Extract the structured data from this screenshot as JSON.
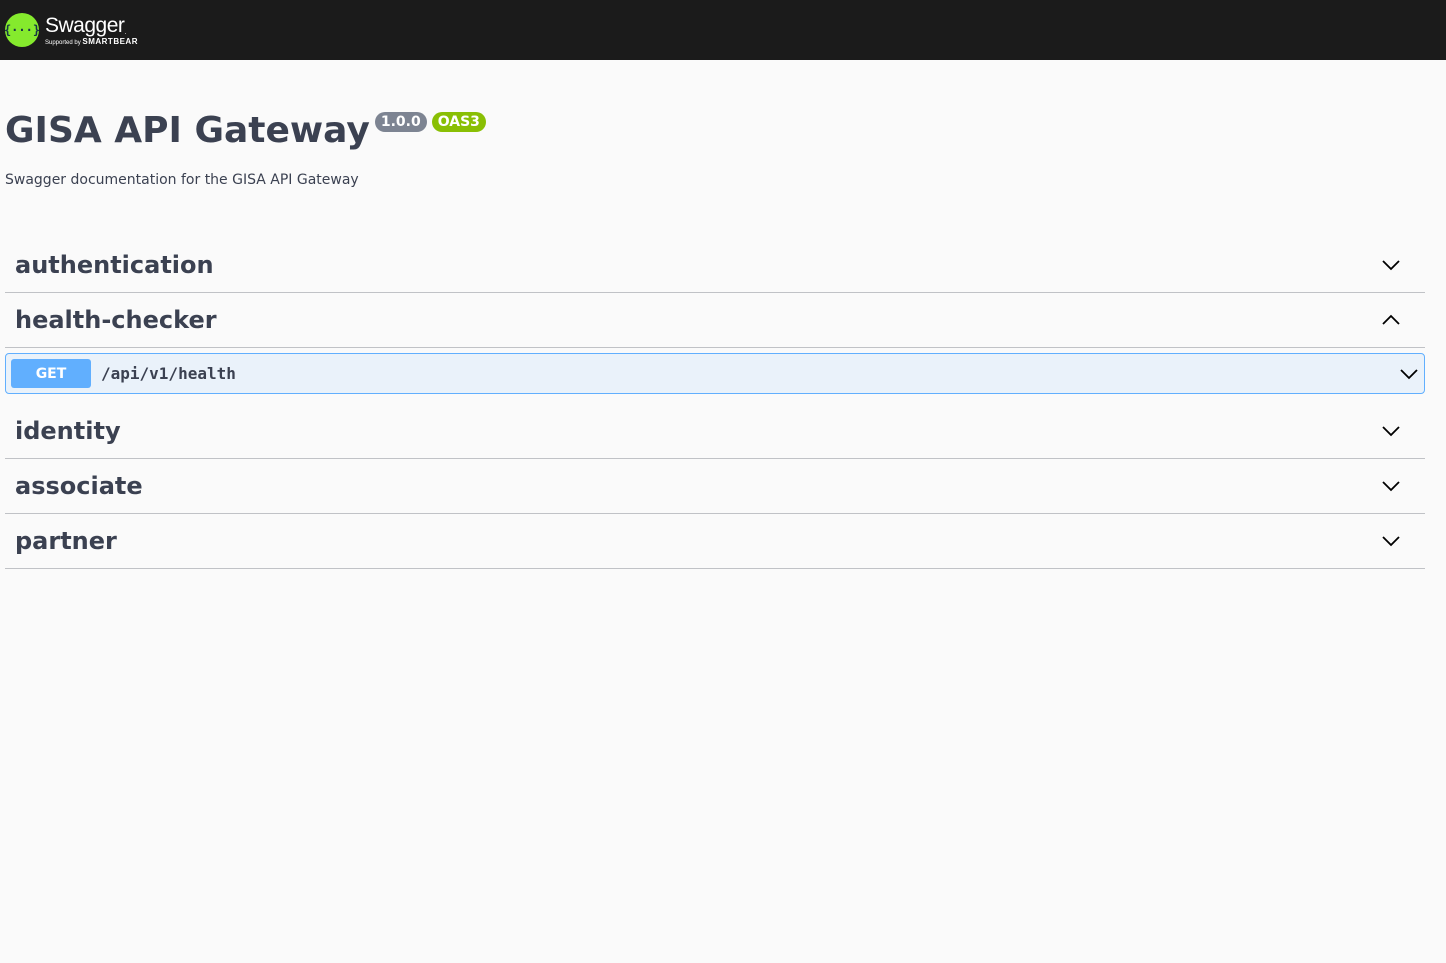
{
  "topbar": {
    "logo_name": "Swagger",
    "logo_supported": "Supported by",
    "logo_brand": "SMARTBEAR",
    "brand_color": "#85ea2d"
  },
  "info": {
    "title": "GISA API Gateway",
    "version": "1.0.0",
    "spec_badge": "OAS3",
    "description": "Swagger documentation for the GISA API Gateway"
  },
  "tags": [
    {
      "name": "authentication",
      "expanded": false
    },
    {
      "name": "health-checker",
      "expanded": true,
      "operations": [
        {
          "method": "GET",
          "path": "/api/v1/health"
        }
      ]
    },
    {
      "name": "identity",
      "expanded": false
    },
    {
      "name": "associate",
      "expanded": false
    },
    {
      "name": "partner",
      "expanded": false
    }
  ],
  "colors": {
    "get": "#61affe",
    "version_badge": "#7d8492",
    "oas_badge": "#89bf04"
  },
  "icons": {
    "collapsed": "chevron-down-icon",
    "expanded": "chevron-up-icon"
  }
}
